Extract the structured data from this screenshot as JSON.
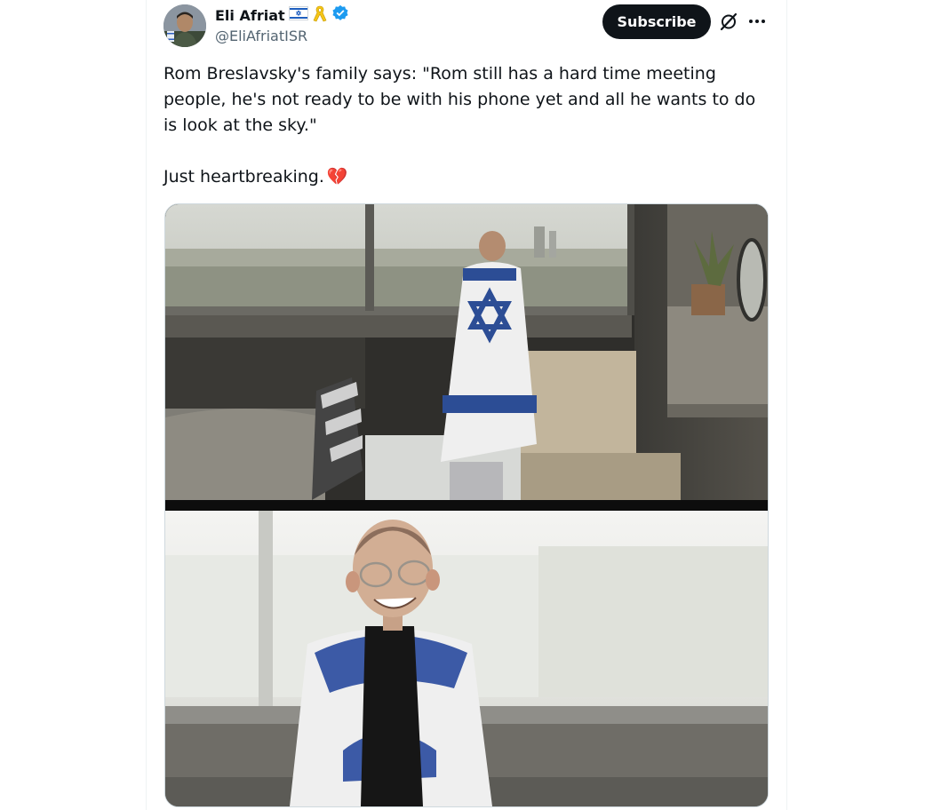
{
  "author": {
    "display_name": "Eli Afriat",
    "handle": "@EliAfriatISR",
    "badges": [
      "israel-flag-emoji",
      "yellow-ribbon-emoji",
      "verified-badge"
    ]
  },
  "actions": {
    "subscribe_label": "Subscribe",
    "grok_icon": "grok-icon",
    "more_icon": "more-icon"
  },
  "tweet": {
    "text_line1": "Rom Breslavsky's family says: \"Rom still has a hard time meeting people, he's not ready to be with his phone yet and all he wants to do is look at the sky.\"",
    "text_line2": "Just heartbreaking.",
    "emoji": "💔"
  },
  "media": {
    "count": 2
  },
  "colors": {
    "text": "#0f1419",
    "secondary": "#536471",
    "verified": "#1d9bf0",
    "button_bg": "#0f1419"
  }
}
